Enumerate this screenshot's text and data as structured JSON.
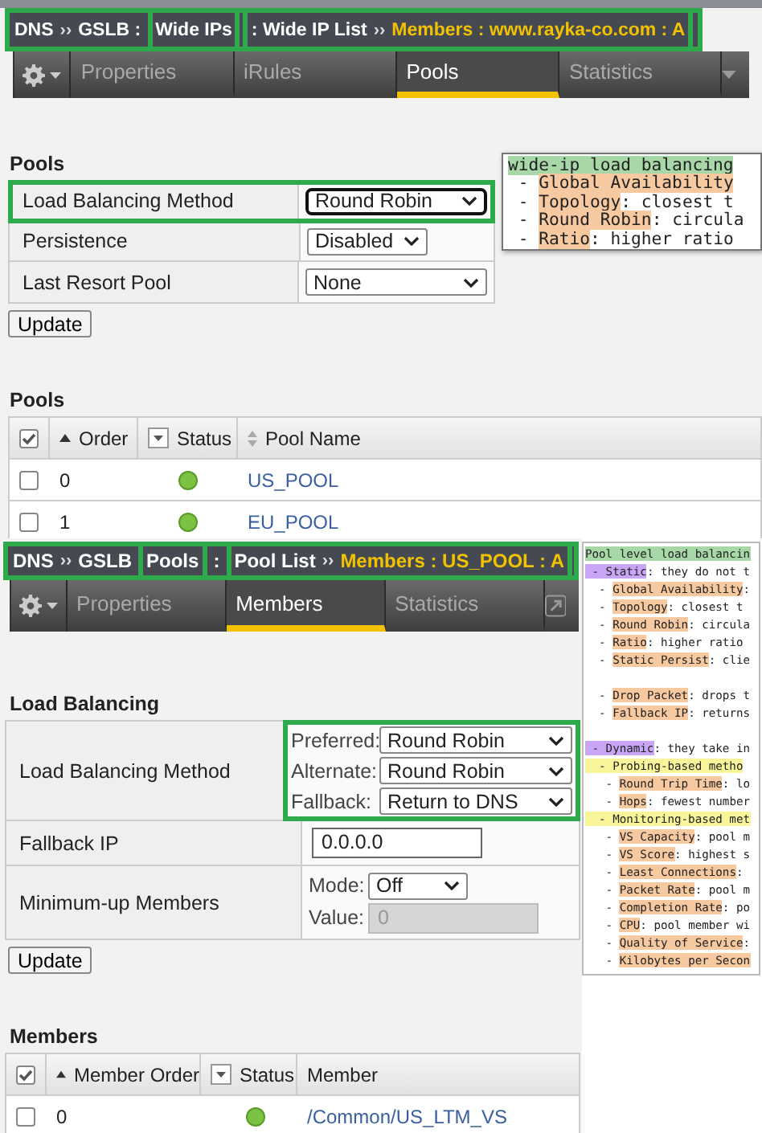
{
  "wide_ip_view": {
    "breadcrumb": {
      "outlined": true,
      "groups": [
        {
          "boxed": false,
          "parts": [
            {
              "text": "DNS",
              "kind": "crumb"
            },
            {
              "text": "››",
              "kind": "separator"
            },
            {
              "text": "GSLB :",
              "kind": "crumb"
            }
          ]
        },
        {
          "boxed": true,
          "parts": [
            {
              "text": "Wide IPs",
              "kind": "crumb"
            }
          ]
        },
        {
          "boxed": true,
          "parts": [
            {
              "text": ": Wide IP List",
              "kind": "crumb"
            },
            {
              "text": "››",
              "kind": "separator"
            },
            {
              "text": "Members : www.rayka-co.com : A",
              "kind": "current"
            }
          ]
        }
      ]
    },
    "tabs": [
      {
        "label": "Properties",
        "selected": false
      },
      {
        "label": "iRules",
        "selected": false
      },
      {
        "label": "Pools",
        "selected": true
      },
      {
        "label": "Statistics",
        "selected": false
      }
    ],
    "settings": {
      "heading": "Pools",
      "rows": [
        {
          "label": "Load Balancing Method",
          "outlined": true,
          "fields": [
            {
              "kind": "select",
              "value": "Round Robin",
              "focused": true
            }
          ]
        },
        {
          "label": "Persistence",
          "outlined": false,
          "fields": [
            {
              "kind": "select",
              "value": "Disabled",
              "focused": false
            }
          ]
        },
        {
          "label": "Last Resort Pool",
          "outlined": false,
          "fields": [
            {
              "kind": "select",
              "value": "None",
              "focused": false
            }
          ]
        }
      ]
    },
    "update_button": "Update",
    "note": [
      {
        "term": "wide-ip load balancing",
        "color": "#a8d8a8",
        "spaced": false
      },
      {
        "lead": " - ",
        "term": "Global Availability",
        "color": "#f7c9a0",
        "spaced": false
      },
      {
        "lead": " - ",
        "term": "Topology",
        "rest": ": closest t",
        "color": "#f7c9a0",
        "spaced": false
      },
      {
        "lead": " - ",
        "term": "Round Robin",
        "rest": ": circula",
        "color": "#f7c9a0",
        "spaced": false
      },
      {
        "lead": " - ",
        "term": "Ratio",
        "rest": ": higher ratio",
        "color": "#f7c9a0",
        "spaced": false
      }
    ],
    "table": {
      "heading": "Pools",
      "header_checked": true,
      "columns": [
        "Order",
        "Status",
        "Pool Name"
      ],
      "rows": [
        {
          "checked": false,
          "order": "0",
          "color": "#7cc242",
          "name": "US_POOL"
        },
        {
          "checked": false,
          "order": "1",
          "color": "#7cc242",
          "name": "EU_POOL"
        }
      ]
    }
  },
  "pool_view": {
    "breadcrumb": {
      "outlined": true,
      "groups": [
        {
          "boxed": false,
          "parts": [
            {
              "text": "DNS",
              "kind": "crumb"
            },
            {
              "text": "››",
              "kind": "separator"
            },
            {
              "text": "GSLB",
              "kind": "crumb"
            }
          ]
        },
        {
          "boxed": true,
          "parts": [
            {
              "text": "Pools",
              "kind": "crumb"
            }
          ]
        },
        {
          "boxed": false,
          "parts": [
            {
              "text": ":",
              "kind": "crumb"
            }
          ]
        },
        {
          "boxed": true,
          "parts": [
            {
              "text": "Pool List",
              "kind": "crumb"
            },
            {
              "text": "››",
              "kind": "separator"
            },
            {
              "text": "Members : US_POOL : A",
              "kind": "current"
            }
          ]
        }
      ]
    },
    "tabs": [
      {
        "label": "Properties",
        "selected": false
      },
      {
        "label": "Members",
        "selected": true
      },
      {
        "label": "Statistics",
        "selected": false
      }
    ],
    "settings": {
      "heading": "Load Balancing",
      "rows": [
        {
          "label": "Load Balancing Method",
          "outlined": true,
          "fields": [
            {
              "kind": "select",
              "label": "Preferred:",
              "value": "Round Robin",
              "focused": false
            },
            {
              "kind": "select",
              "label": "Alternate:",
              "value": "Round Robin",
              "focused": false
            },
            {
              "kind": "select",
              "label": "Fallback:",
              "value": "Return to DNS",
              "focused": false
            }
          ]
        },
        {
          "label": "Fallback IP",
          "outlined": false,
          "fields": [
            {
              "kind": "input",
              "value": "0.0.0.0",
              "disabled": false
            }
          ]
        },
        {
          "label": "Minimum-up Members",
          "outlined": false,
          "fields": [
            {
              "kind": "select",
              "label": "Mode:",
              "value": "Off",
              "focused": false
            },
            {
              "kind": "input",
              "label": "Value:",
              "value": "0",
              "disabled": true
            }
          ]
        }
      ]
    },
    "update_button": "Update",
    "note": [
      {
        "term": "Pool level load balancin",
        "color": "#a8d8a8",
        "spaced": false
      },
      {
        "term": " - Static",
        "rest": ": they do not t",
        "color": "#c9a6f5",
        "spaced": false
      },
      {
        "lead": "  - ",
        "term": "Global Availability",
        "rest": ":",
        "color": "#f7c9a0",
        "spaced": false
      },
      {
        "lead": "  - ",
        "term": "Topology",
        "rest": ": closest t",
        "color": "#f7c9a0",
        "spaced": false
      },
      {
        "lead": "  - ",
        "term": "Round Robin",
        "rest": ": circula",
        "color": "#f7c9a0",
        "spaced": false
      },
      {
        "lead": "  - ",
        "term": "Ratio",
        "rest": ": higher ratio",
        "color": "#f7c9a0",
        "spaced": false
      },
      {
        "lead": "  - ",
        "term": "Static Persist",
        "rest": ": clie",
        "color": "#f7c9a0",
        "spaced": false
      },
      {
        "lead": "  - ",
        "term": "Drop Packet",
        "rest": ": drops t",
        "color": "#f7c9a0",
        "spaced": true
      },
      {
        "lead": "  - ",
        "term": "Fallback IP",
        "rest": ": returns",
        "color": "#f7c9a0",
        "spaced": false
      },
      {
        "term": " - Dynamic",
        "rest": ": they take in",
        "color": "#c9a6f5",
        "spaced": true
      },
      {
        "term": "  - Probing-based metho",
        "color": "#f9f59a",
        "spaced": false
      },
      {
        "lead": "   - ",
        "term": "Round Trip Time",
        "rest": ": lo",
        "color": "#f7c9a0",
        "spaced": false
      },
      {
        "lead": "   - ",
        "term": "Hops",
        "rest": ": fewest number",
        "color": "#f7c9a0",
        "spaced": false
      },
      {
        "term": "  - Monitoring-based met",
        "color": "#f9f59a",
        "spaced": false
      },
      {
        "lead": "   - ",
        "term": "VS Capacity",
        "rest": ": pool m",
        "color": "#f7c9a0",
        "spaced": false
      },
      {
        "lead": "   - ",
        "term": "VS Score",
        "rest": ": highest s",
        "color": "#f7c9a0",
        "spaced": false
      },
      {
        "lead": "   - ",
        "term": "Least Connections",
        "rest": ":",
        "color": "#f7c9a0",
        "spaced": false
      },
      {
        "lead": "   - ",
        "term": "Packet Rate",
        "rest": ": pool m",
        "color": "#f7c9a0",
        "spaced": false
      },
      {
        "lead": "   - ",
        "term": "Completion Rate",
        "rest": ": po",
        "color": "#f7c9a0",
        "spaced": false
      },
      {
        "lead": "   - ",
        "term": "CPU",
        "rest": ": pool member wi",
        "color": "#f7c9a0",
        "spaced": false
      },
      {
        "lead": "   - ",
        "term": "Quality of Service",
        "rest": ":",
        "color": "#f7c9a0",
        "spaced": false
      },
      {
        "lead": "   - ",
        "term": "Kilobytes per Secon",
        "color": "#f7c9a0",
        "spaced": false
      }
    ],
    "table": {
      "heading": "Members",
      "header_checked": true,
      "columns": [
        "Member Order",
        "Status",
        "Member"
      ],
      "rows": [
        {
          "checked": false,
          "order": "0",
          "color": "#7cc242",
          "name": "/Common/US_LTM_VS"
        }
      ]
    }
  }
}
